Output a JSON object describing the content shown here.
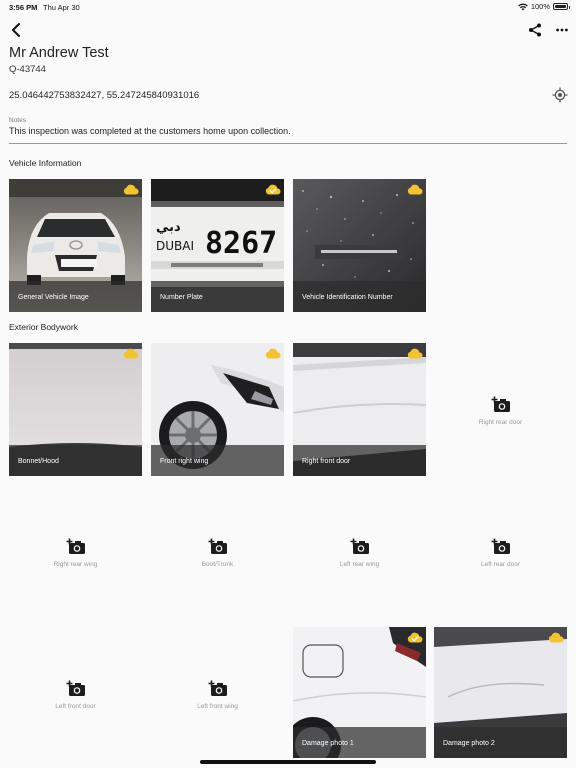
{
  "status_bar": {
    "time": "3:56 PM",
    "date": "Thu Apr 30",
    "battery": "100%"
  },
  "header": {
    "customer_name": "Mr Andrew Test",
    "quote_id": "Q-43744",
    "coordinates": "25.046442753832427, 55.247245840931016"
  },
  "notes": {
    "label": "Notes",
    "value": "This inspection was completed at the customers home upon collection."
  },
  "sections": {
    "vehicle_information": "Vehicle Information",
    "exterior_bodywork": "Exterior Bodywork"
  },
  "vehicle_tiles": [
    {
      "label": "General Vehicle Image",
      "upload_state": "uploading"
    },
    {
      "label": "Number Plate",
      "upload_state": "uploaded",
      "plate_arabic": "دبي",
      "plate_city": "DUBAI",
      "plate_number": "8267"
    },
    {
      "label": "Vehicle Identification Number",
      "upload_state": "uploading"
    }
  ],
  "exterior_tiles": [
    {
      "label": "Bonnet/Hood",
      "upload_state": "uploading"
    },
    {
      "label": "Front right wing",
      "upload_state": "uploading"
    },
    {
      "label": "Right front door",
      "upload_state": "uploading"
    }
  ],
  "empty_slots": [
    {
      "label": "Right rear door"
    },
    {
      "label": "Right rear wing"
    },
    {
      "label": "Boot/Trunk"
    },
    {
      "label": "Left rear wing"
    },
    {
      "label": "Left rear door"
    },
    {
      "label": "Left front door"
    },
    {
      "label": "Left front wing"
    }
  ],
  "damage_tiles": [
    {
      "label": "Damage photo 1",
      "upload_state": "uploaded"
    },
    {
      "label": "Damage photo 2",
      "upload_state": "uploading"
    }
  ],
  "colors": {
    "cloud": "#f2c230",
    "caption_overlay": "#2d2d2d",
    "placeholder_text": "#999999"
  }
}
